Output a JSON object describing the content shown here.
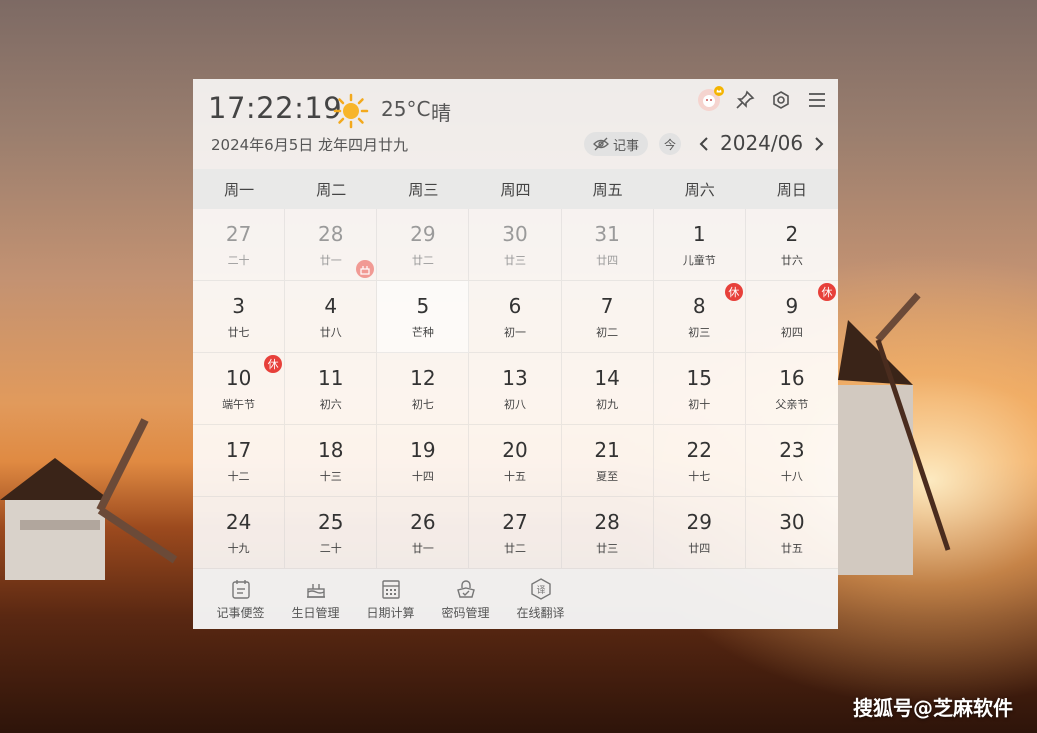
{
  "header": {
    "time": "17:22:19",
    "temperature": "25°C",
    "weather": "晴",
    "date_line": "2024年6月5日 龙年四月廿九",
    "memo_label": "记事",
    "today_label": "今",
    "month_label": "2024/06"
  },
  "weekdays": [
    "周一",
    "周二",
    "周三",
    "周四",
    "周五",
    "周六",
    "周日"
  ],
  "days": [
    {
      "num": "27",
      "lunar": "二十",
      "other": true
    },
    {
      "num": "28",
      "lunar": "廿一",
      "other": true,
      "birthday": true
    },
    {
      "num": "29",
      "lunar": "廿二",
      "other": true
    },
    {
      "num": "30",
      "lunar": "廿三",
      "other": true
    },
    {
      "num": "31",
      "lunar": "廿四",
      "other": true
    },
    {
      "num": "1",
      "lunar": "儿童节"
    },
    {
      "num": "2",
      "lunar": "廿六"
    },
    {
      "num": "3",
      "lunar": "廿七"
    },
    {
      "num": "4",
      "lunar": "廿八"
    },
    {
      "num": "5",
      "lunar": "芒种",
      "today": true
    },
    {
      "num": "6",
      "lunar": "初一"
    },
    {
      "num": "7",
      "lunar": "初二"
    },
    {
      "num": "8",
      "lunar": "初三",
      "badge": "休"
    },
    {
      "num": "9",
      "lunar": "初四",
      "badge": "休"
    },
    {
      "num": "10",
      "lunar": "端午节",
      "badge": "休"
    },
    {
      "num": "11",
      "lunar": "初六"
    },
    {
      "num": "12",
      "lunar": "初七"
    },
    {
      "num": "13",
      "lunar": "初八"
    },
    {
      "num": "14",
      "lunar": "初九"
    },
    {
      "num": "15",
      "lunar": "初十"
    },
    {
      "num": "16",
      "lunar": "父亲节"
    },
    {
      "num": "17",
      "lunar": "十二"
    },
    {
      "num": "18",
      "lunar": "十三"
    },
    {
      "num": "19",
      "lunar": "十四"
    },
    {
      "num": "20",
      "lunar": "十五"
    },
    {
      "num": "21",
      "lunar": "夏至"
    },
    {
      "num": "22",
      "lunar": "十七"
    },
    {
      "num": "23",
      "lunar": "十八"
    },
    {
      "num": "24",
      "lunar": "十九"
    },
    {
      "num": "25",
      "lunar": "二十"
    },
    {
      "num": "26",
      "lunar": "廿一"
    },
    {
      "num": "27",
      "lunar": "廿二"
    },
    {
      "num": "28",
      "lunar": "廿三"
    },
    {
      "num": "29",
      "lunar": "廿四"
    },
    {
      "num": "30",
      "lunar": "廿五"
    }
  ],
  "toolbar": [
    {
      "label": "记事便签",
      "icon": "notepad-icon"
    },
    {
      "label": "生日管理",
      "icon": "cake-icon"
    },
    {
      "label": "日期计算",
      "icon": "calculator-icon"
    },
    {
      "label": "密码管理",
      "icon": "lock-icon"
    },
    {
      "label": "在线翻译",
      "icon": "translate-icon"
    }
  ],
  "watermark": "搜狐号@芝麻软件",
  "colors": {
    "holiday_badge": "#e7403a",
    "birthday_badge": "#f19a94"
  }
}
